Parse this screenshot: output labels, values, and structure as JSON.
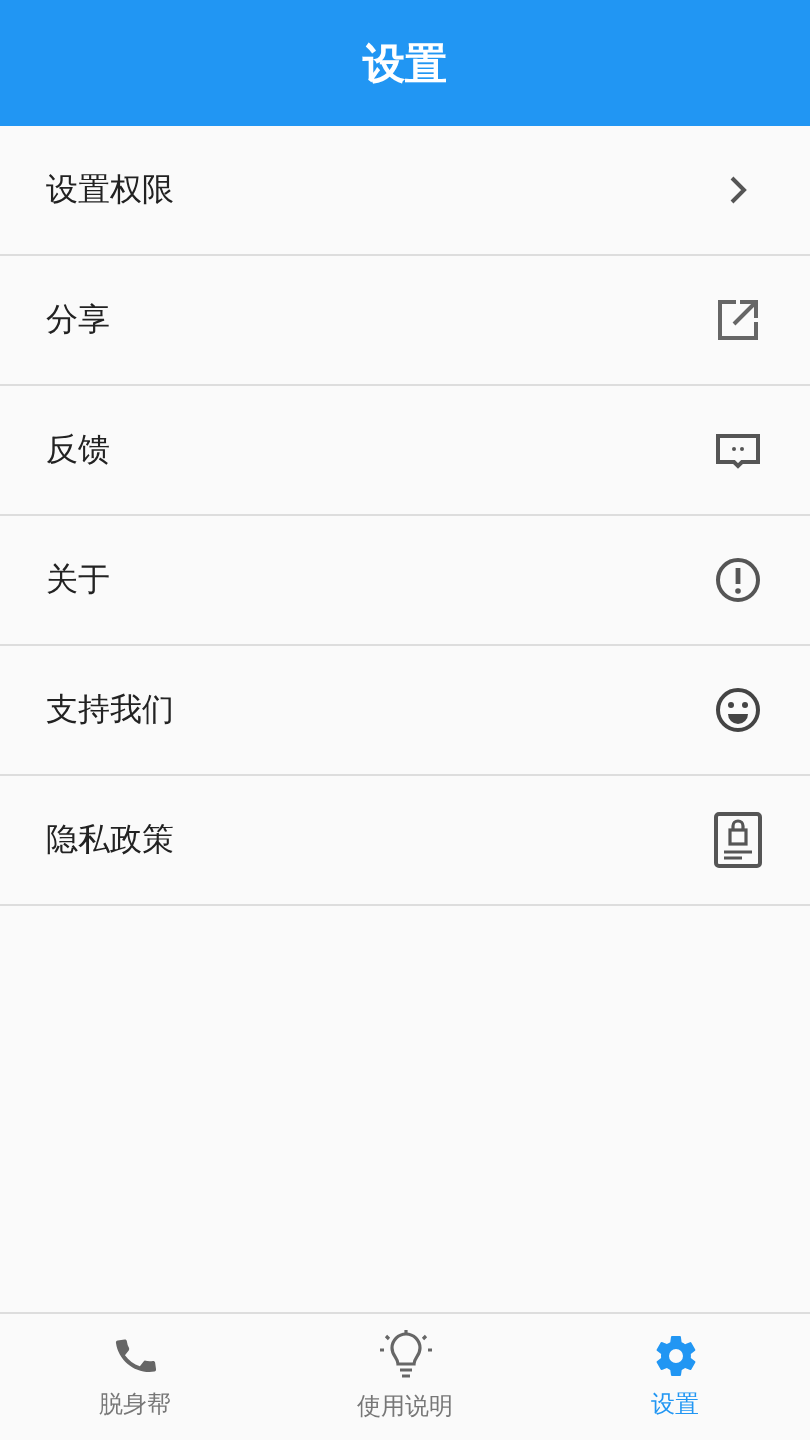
{
  "header": {
    "title": "设置"
  },
  "menu": [
    {
      "label": "设置权限",
      "kind": "chevron"
    },
    {
      "label": "分享",
      "kind": "share"
    },
    {
      "label": "反馈",
      "kind": "feedback"
    },
    {
      "label": "关于",
      "kind": "info"
    },
    {
      "label": "支持我们",
      "kind": "smile"
    },
    {
      "label": "隐私政策",
      "kind": "privacy"
    }
  ],
  "tabs": [
    {
      "label": "脱身帮",
      "kind": "phone",
      "selected": false
    },
    {
      "label": "使用说明",
      "kind": "bulb",
      "selected": false
    },
    {
      "label": "设置",
      "kind": "gear",
      "selected": true
    }
  ]
}
